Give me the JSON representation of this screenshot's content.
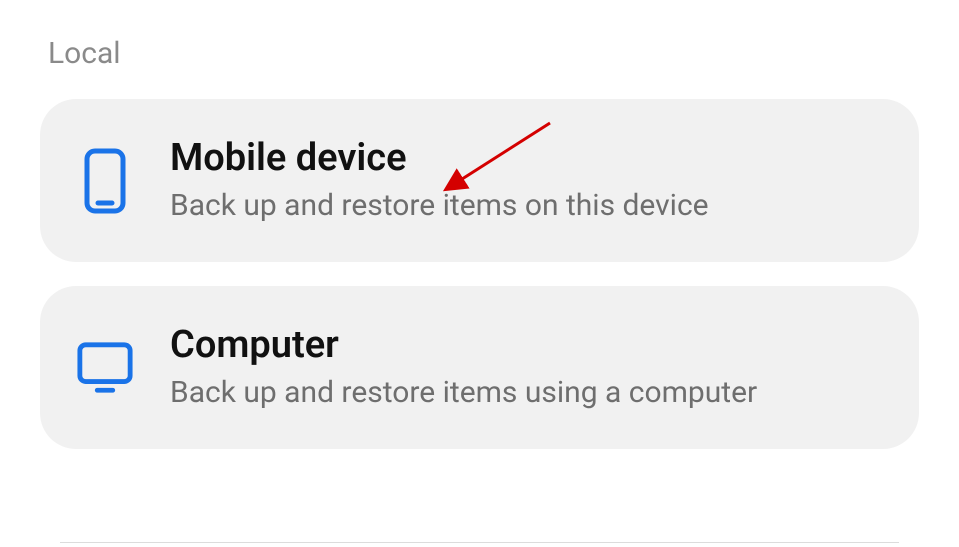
{
  "section": {
    "header": "Local",
    "items": [
      {
        "title": "Mobile device",
        "subtitle": "Back up and restore items on this device",
        "icon": "phone-icon"
      },
      {
        "title": "Computer",
        "subtitle": "Back up and restore items using a computer",
        "icon": "monitor-icon"
      }
    ]
  },
  "colors": {
    "accent": "#1a73e8",
    "annotation": "#d40000"
  }
}
